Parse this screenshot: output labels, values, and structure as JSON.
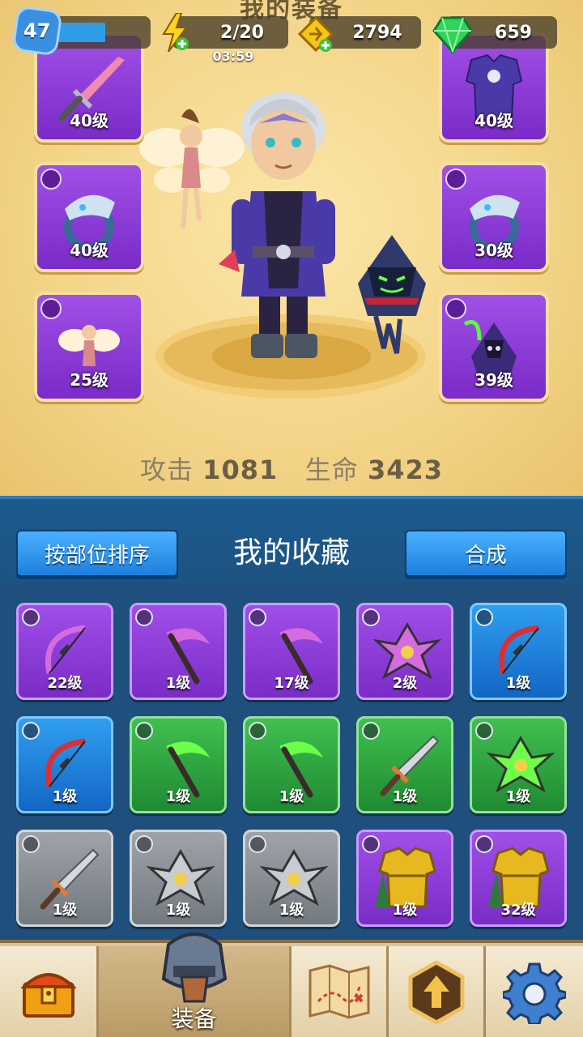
{
  "screen": {
    "title": "我的装备"
  },
  "status_bar": {
    "level": "47",
    "level_progress": 0.4,
    "energy": "2/20",
    "energy_timer": "03:59",
    "gold": "2794",
    "gems": "659"
  },
  "equip_slots": [
    {
      "id": "weapon",
      "icon": "sword-icon",
      "level": "40级"
    },
    {
      "id": "armor",
      "icon": "armor-icon",
      "level": "40级"
    },
    {
      "id": "ring-left",
      "icon": "ring-icon",
      "level": "40级"
    },
    {
      "id": "ring-right",
      "icon": "ring-icon",
      "level": "30级"
    },
    {
      "id": "pet-left",
      "icon": "paw-icon",
      "level": "25级"
    },
    {
      "id": "pet-right",
      "icon": "paw-icon",
      "level": "39级"
    }
  ],
  "stats": {
    "attack_label": "攻击",
    "attack": "1081",
    "hp_label": "生命",
    "hp": "3423"
  },
  "collection": {
    "title": "我的收藏",
    "sort_label": "按部位排序",
    "merge_label": "合成"
  },
  "items": [
    {
      "art": "bow-icon",
      "rarity": "purple",
      "level": "22级"
    },
    {
      "art": "scythe-icon",
      "rarity": "purple",
      "level": "1级"
    },
    {
      "art": "scythe-icon",
      "rarity": "purple",
      "level": "17级"
    },
    {
      "art": "shuriken-icon",
      "rarity": "purple",
      "level": "2级"
    },
    {
      "art": "bow-icon",
      "rarity": "blue",
      "level": "1级"
    },
    {
      "art": "bow-icon",
      "rarity": "blue",
      "level": "1级"
    },
    {
      "art": "scythe-icon",
      "rarity": "green",
      "level": "1级"
    },
    {
      "art": "scythe-icon",
      "rarity": "green",
      "level": "1级"
    },
    {
      "art": "sword-icon",
      "rarity": "green",
      "level": "1级"
    },
    {
      "art": "shuriken-icon",
      "rarity": "green",
      "level": "1级"
    },
    {
      "art": "sword-icon",
      "rarity": "gray",
      "level": "1级"
    },
    {
      "art": "shuriken-icon",
      "rarity": "gray",
      "level": "1级"
    },
    {
      "art": "shuriken-icon",
      "rarity": "gray",
      "level": "1级"
    },
    {
      "art": "golden-armor-icon",
      "rarity": "purple",
      "level": "1级"
    },
    {
      "art": "golden-armor-icon",
      "rarity": "purple",
      "level": "32级"
    }
  ],
  "nav": {
    "equip_label": "装备"
  }
}
